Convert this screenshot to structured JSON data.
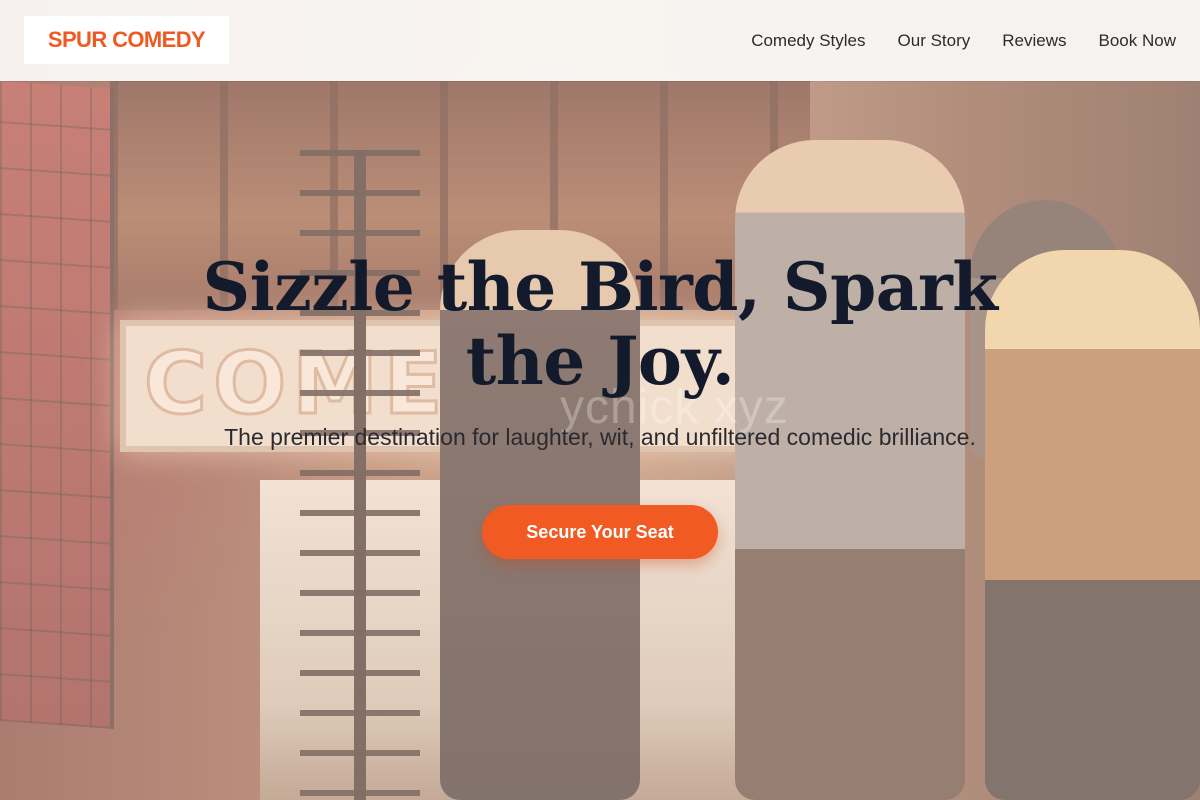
{
  "brand": {
    "logo_text": "SPUR COMEDY",
    "accent_color": "#f15a22",
    "logo_color": "#ee5a23"
  },
  "nav": {
    "items": [
      {
        "label": "Comedy Styles"
      },
      {
        "label": "Our Story"
      },
      {
        "label": "Reviews"
      },
      {
        "label": "Book Now"
      }
    ]
  },
  "hero": {
    "title": "Sizzle the Bird, Spark the Joy.",
    "subtitle": "The premier destination for laughter, wit, and unfiltered comedic brilliance.",
    "cta_label": "Secure Your Seat",
    "background_photo": {
      "marquee_text": "COMEDY",
      "watermark_text": "ychick xyz"
    }
  }
}
